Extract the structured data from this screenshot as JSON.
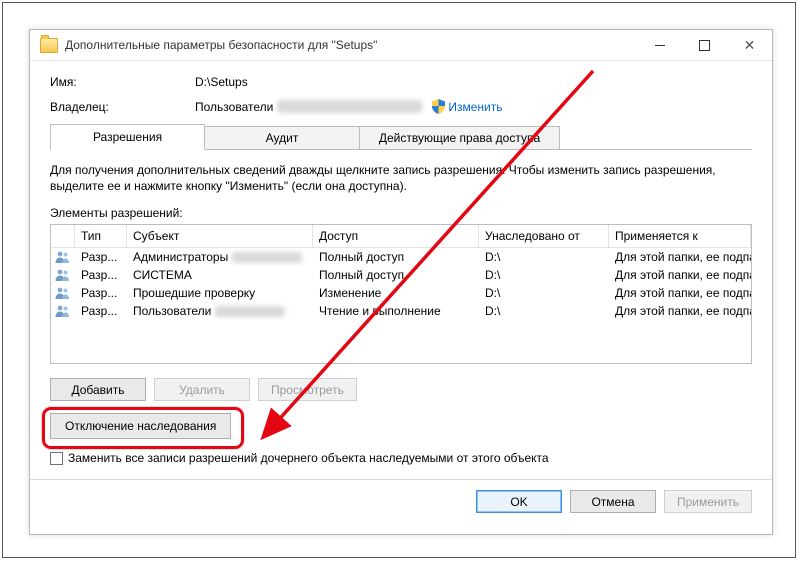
{
  "window": {
    "title": "Дополнительные параметры безопасности  для \"Setups\""
  },
  "labels": {
    "name": "Имя:",
    "owner": "Владелец:",
    "name_value": "D:\\Setups",
    "owner_value_prefix": "Пользователи",
    "change_link": "Изменить"
  },
  "tabs": [
    {
      "label": "Разрешения",
      "active": true
    },
    {
      "label": "Аудит",
      "active": false
    },
    {
      "label": "Действующие права доступа",
      "active": false
    }
  ],
  "info_text": "Для получения дополнительных сведений дважды щелкните запись разрешения. Чтобы изменить запись разрешения, выделите ее и нажмите кнопку \"Изменить\" (если она доступна).",
  "list_label": "Элементы разрешений:",
  "columns": {
    "type": "Тип",
    "subject": "Субъект",
    "access": "Доступ",
    "inherited": "Унаследовано от",
    "applies": "Применяется к"
  },
  "rows": [
    {
      "type": "Разр...",
      "subject": "Администраторы",
      "subject_blur": true,
      "access": "Полный доступ",
      "inherited": "D:\\",
      "applies": "Для этой папки, ее подпапок ..."
    },
    {
      "type": "Разр...",
      "subject": "СИСТЕМА",
      "subject_blur": false,
      "access": "Полный доступ",
      "inherited": "D:\\",
      "applies": "Для этой папки, ее подпапок ..."
    },
    {
      "type": "Разр...",
      "subject": "Прошедшие проверку",
      "subject_blur": false,
      "access": "Изменение",
      "inherited": "D:\\",
      "applies": "Для этой папки, ее подпапок ..."
    },
    {
      "type": "Разр...",
      "subject": "Пользователи",
      "subject_blur": true,
      "access": "Чтение и выполнение",
      "inherited": "D:\\",
      "applies": "Для этой папки, ее подпапок ..."
    }
  ],
  "buttons": {
    "add": "Добавить",
    "delete": "Удалить",
    "view": "Просмотреть",
    "disable_inherit": "Отключение наследования",
    "ok": "OK",
    "cancel": "Отмена",
    "apply": "Применить"
  },
  "checkbox_label": "Заменить все записи разрешений дочернего объекта наследуемыми от этого объекта",
  "annotation": {
    "arrow_color": "#e30613"
  }
}
